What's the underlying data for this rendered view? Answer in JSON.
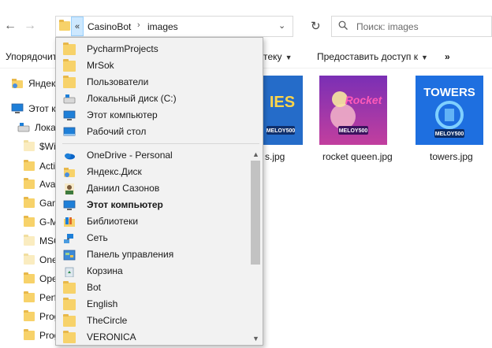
{
  "nav": {
    "back_glyph": "←",
    "forward_glyph": "→"
  },
  "address": {
    "chevron": "«",
    "crumbs": [
      "CasinoBot",
      "images"
    ],
    "separator": "›",
    "dropdown_glyph": "⌄",
    "refresh_glyph": "↻"
  },
  "search": {
    "placeholder": "Поиск: images"
  },
  "command_bar": {
    "organize_label": "Упорядочить",
    "library_label": "тeку",
    "share_label": "Предоставить доступ к",
    "more_label": "»"
  },
  "nav_pane": {
    "items": [
      {
        "label": "Яндекс",
        "icon": "yandex-disk-icon"
      },
      {
        "label": "Этот ко",
        "icon": "computer-icon"
      },
      {
        "label": "Лока",
        "icon": "drive-icon"
      },
      {
        "label": "$Wi",
        "icon": "folder-icon"
      },
      {
        "label": "Acti",
        "icon": "folder-icon"
      },
      {
        "label": "Ava",
        "icon": "folder-icon"
      },
      {
        "label": "Gam",
        "icon": "folder-icon"
      },
      {
        "label": "G-M",
        "icon": "folder-icon"
      },
      {
        "label": "MSC",
        "icon": "folder-icon"
      },
      {
        "label": "One",
        "icon": "folder-icon"
      },
      {
        "label": "Ope",
        "icon": "folder-icon"
      },
      {
        "label": "Perf",
        "icon": "folder-icon"
      },
      {
        "label": "Prog",
        "icon": "folder-icon"
      },
      {
        "label": "Prog",
        "icon": "folder-icon"
      }
    ]
  },
  "files": [
    {
      "name": "s.jpg",
      "thumb_text": "IES",
      "badge": "MELOY500",
      "bg": "#2a7bd8"
    },
    {
      "name": "rocket queen.jpg",
      "thumb_text": "Rocket",
      "badge": "MELOY500",
      "bg": "#7a2fb5"
    },
    {
      "name": "towers.jpg",
      "thumb_text": "TOWERS",
      "badge": "MELOY500",
      "bg": "#1e6fe0"
    }
  ],
  "dropdown": {
    "items": [
      {
        "label": "PycharmProjects",
        "icon": "folder-icon",
        "bold": false
      },
      {
        "label": "MrSok",
        "icon": "folder-icon",
        "bold": false
      },
      {
        "label": "Пользователи",
        "icon": "folder-icon",
        "bold": false
      },
      {
        "label": "Локальный диск (C:)",
        "icon": "drive-icon",
        "bold": false
      },
      {
        "label": "Этот компьютер",
        "icon": "computer-icon",
        "bold": false
      },
      {
        "label": "Рабочий стол",
        "icon": "desktop-icon",
        "bold": false
      },
      {
        "label": "OneDrive - Personal",
        "icon": "onedrive-icon",
        "bold": false
      },
      {
        "label": "Яндекс.Диск",
        "icon": "yandex-disk-icon",
        "bold": false
      },
      {
        "label": "Даниил Сазонов",
        "icon": "user-icon",
        "bold": false
      },
      {
        "label": "Этот компьютер",
        "icon": "computer-icon",
        "bold": true
      },
      {
        "label": "Библиотеки",
        "icon": "libraries-icon",
        "bold": false
      },
      {
        "label": "Сеть",
        "icon": "network-icon",
        "bold": false
      },
      {
        "label": "Панель управления",
        "icon": "control-panel-icon",
        "bold": false
      },
      {
        "label": "Корзина",
        "icon": "recycle-bin-icon",
        "bold": false
      },
      {
        "label": "Bot",
        "icon": "folder-icon",
        "bold": false
      },
      {
        "label": "English",
        "icon": "folder-icon",
        "bold": false
      },
      {
        "label": "TheCircle",
        "icon": "folder-icon",
        "bold": false
      },
      {
        "label": "VERONICA",
        "icon": "folder-icon",
        "bold": false
      }
    ],
    "scroll_up_glyph": "▲",
    "scroll_down_glyph": "▼"
  },
  "colors": {
    "accent": "#cde8ff",
    "folder": "#f7d26a",
    "windows_blue": "#0078d7"
  }
}
